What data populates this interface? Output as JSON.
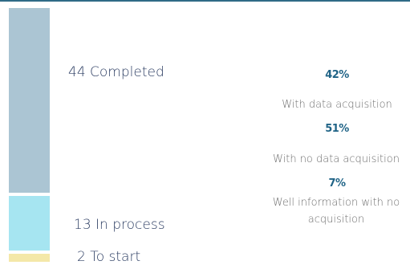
{
  "chart_data": {
    "type": "bar",
    "stacked": true,
    "categories": [
      "Completed",
      "In process",
      "To start"
    ],
    "values": [
      44,
      13,
      2
    ],
    "segment_labels": [
      "44 Completed",
      "13 In process",
      "2 To start"
    ],
    "colors": [
      "#abc5d3",
      "#a6e5f1",
      "#f4e8a8"
    ],
    "breakdown": [
      {
        "percent": "42%",
        "label": "With data acquisition"
      },
      {
        "percent": "51%",
        "label": "With no data acquisition"
      },
      {
        "percent": "7%",
        "label": "Well information with no acquisition"
      }
    ]
  }
}
